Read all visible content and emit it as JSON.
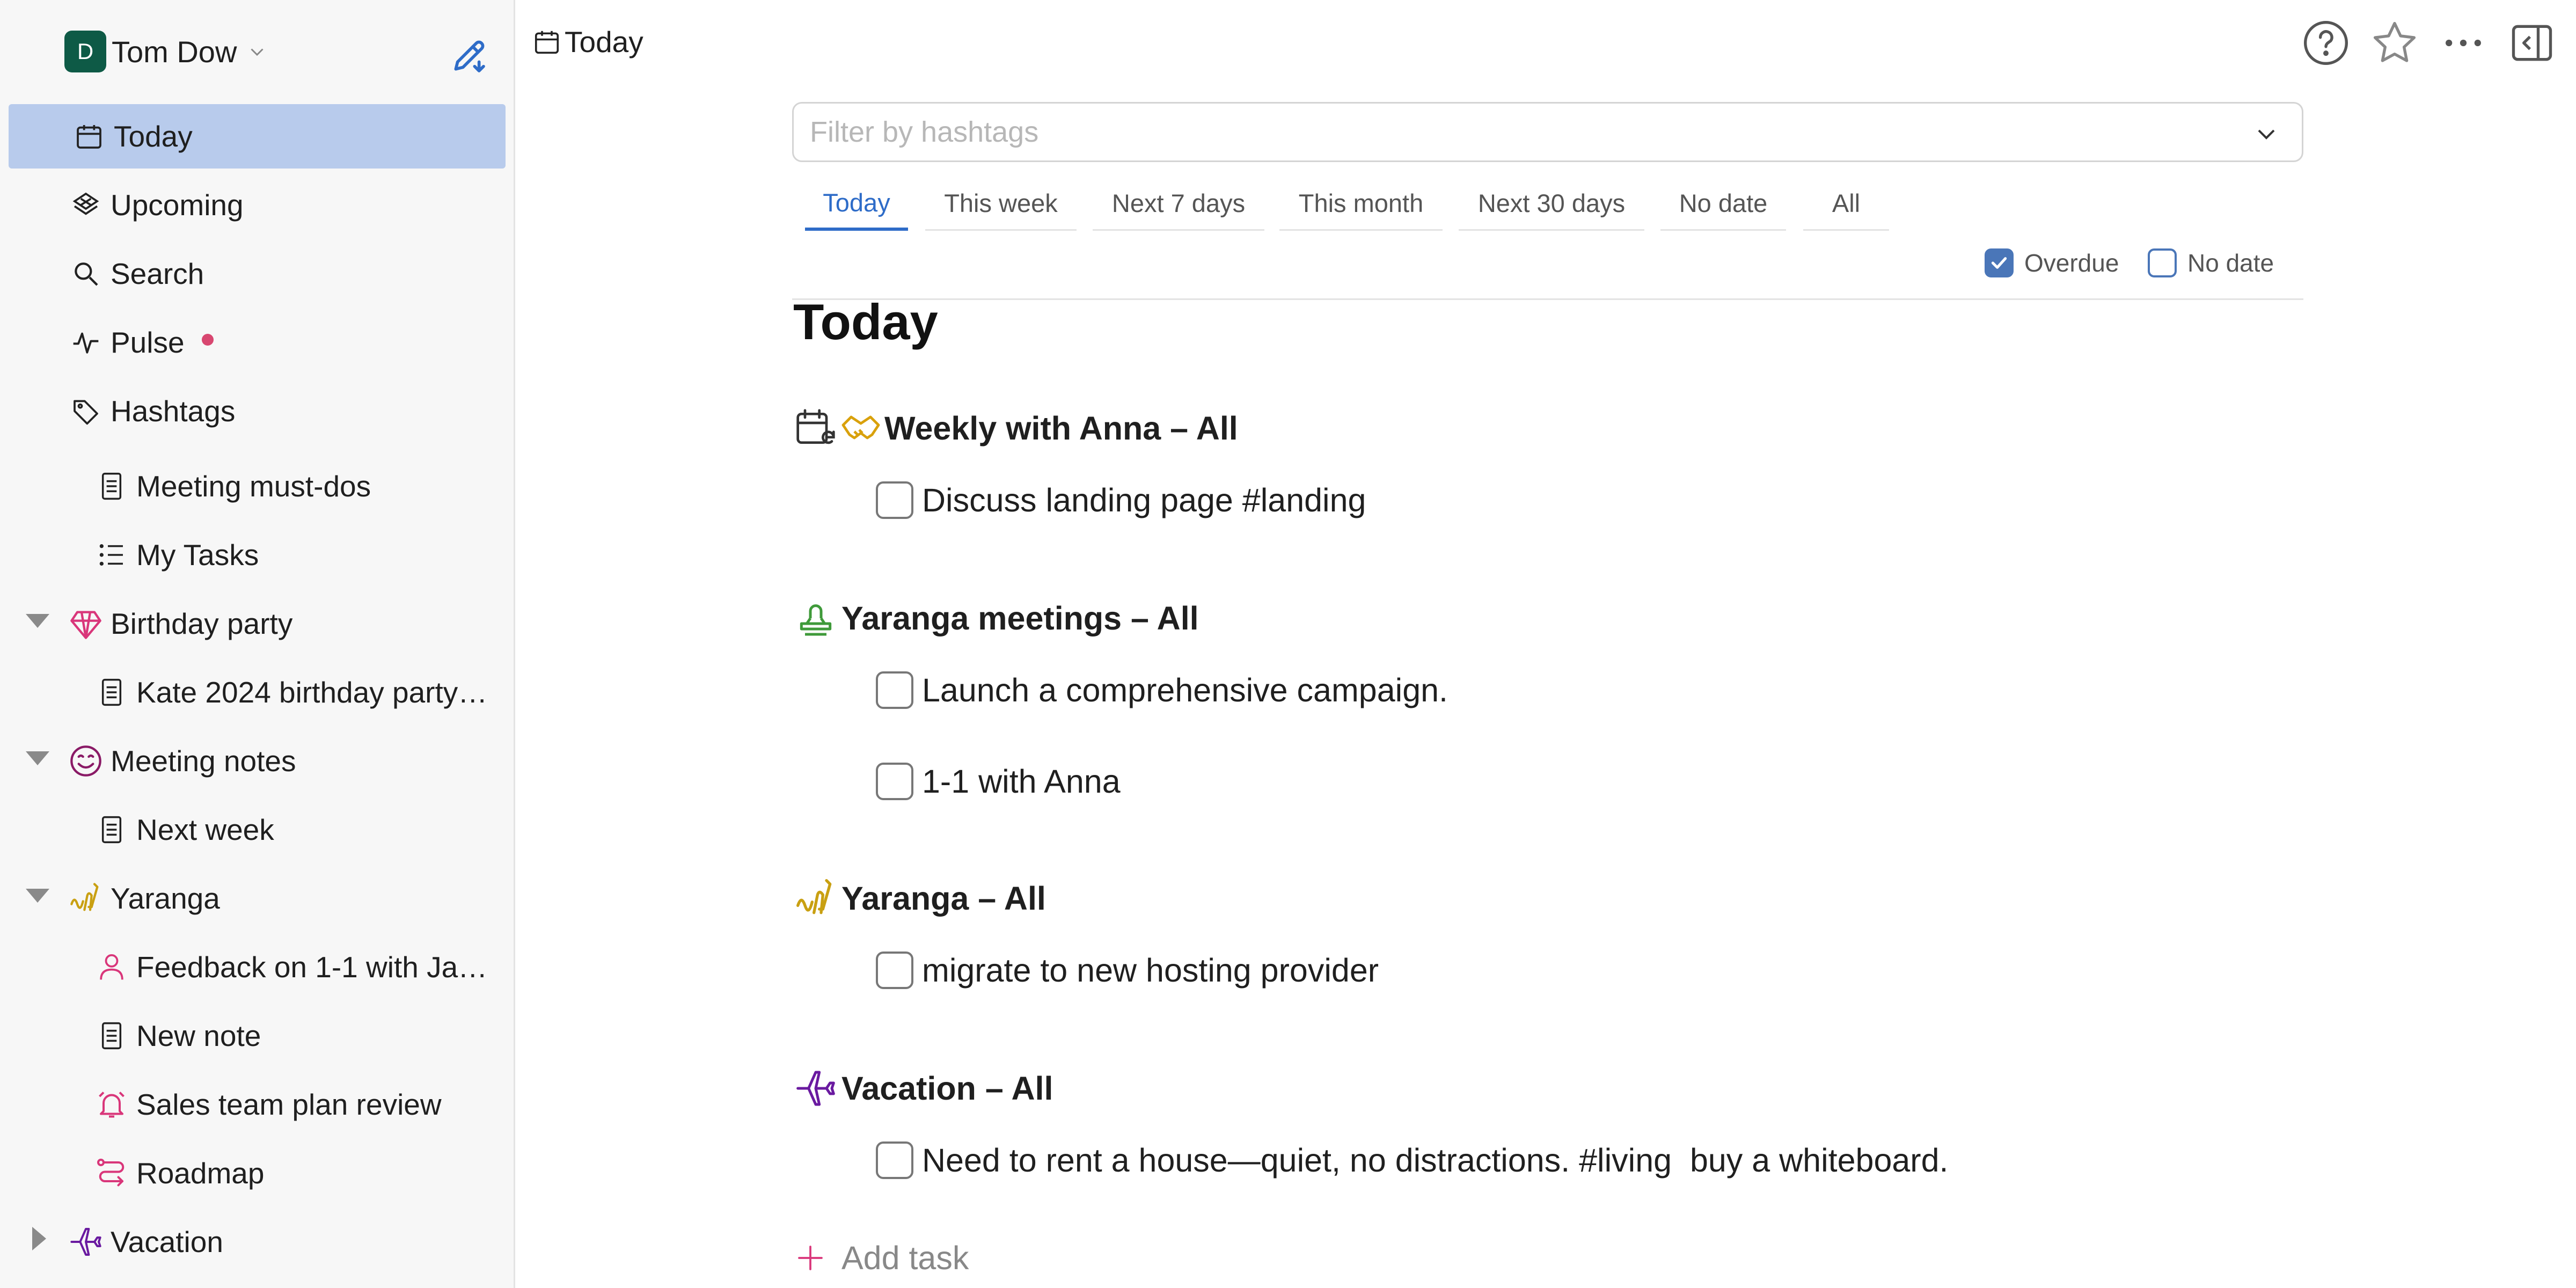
{
  "colors": {
    "accent": "#2e6cc8",
    "active_bg": "#b8cbec",
    "avatar_bg": "#0e5a46",
    "pulse_dot": "#d84770",
    "birthday_icon": "#d9367a",
    "meeting_icon": "#8a1a66",
    "yaranga_icon": "#c9a012",
    "vacation_icon": "#6a1aa0",
    "stamp_icon": "#3f9a3a"
  },
  "account": {
    "avatar_letter": "D",
    "name": "Tom Dow",
    "icon": "chevron-down-icon"
  },
  "sidebar": {
    "new_note_icon": "pencil-edit-icon",
    "items": [
      {
        "label": "Today",
        "icon": "calendar-icon",
        "active": true
      },
      {
        "label": "Upcoming",
        "icon": "upcoming-icon"
      },
      {
        "label": "Search",
        "icon": "search-icon"
      },
      {
        "label": "Pulse",
        "icon": "pulse-icon",
        "has_dot": true
      },
      {
        "label": "Hashtags",
        "icon": "tag-icon"
      },
      {
        "label": "Meeting must-dos",
        "icon": "note-icon"
      },
      {
        "label": "My Tasks",
        "icon": "list-icon"
      },
      {
        "label": "Birthday party",
        "icon": "gem-icon",
        "expanded": true
      },
      {
        "label": "Kate 2024 birthday party…",
        "icon": "note-icon"
      },
      {
        "label": "Meeting notes",
        "icon": "smile-icon",
        "expanded": true
      },
      {
        "label": "Next week",
        "icon": "note-icon"
      },
      {
        "label": "Yaranga",
        "icon": "yaranga-icon",
        "expanded": true
      },
      {
        "label": "Feedback on 1-1 with Ja…",
        "icon": "person-icon"
      },
      {
        "label": "New note",
        "icon": "note-icon"
      },
      {
        "label": "Sales team plan review",
        "icon": "bell-icon"
      },
      {
        "label": "Roadmap",
        "icon": "route-icon"
      },
      {
        "label": "Vacation",
        "icon": "plane-icon",
        "expanded": false
      }
    ]
  },
  "topbar": {
    "title": "Today",
    "icons": [
      "help-icon",
      "star-icon",
      "more-icon",
      "sidebar-toggle-icon"
    ]
  },
  "main": {
    "filter": {
      "placeholder": "Filter by hashtags",
      "value": ""
    },
    "tabs": [
      {
        "label": "Today",
        "active": true
      },
      {
        "label": "This week"
      },
      {
        "label": "Next 7 days"
      },
      {
        "label": "This month"
      },
      {
        "label": "Next 30 days"
      },
      {
        "label": "No date"
      },
      {
        "label": "All"
      }
    ],
    "toggles": {
      "overdue": {
        "label": "Overdue",
        "checked": true
      },
      "nodate": {
        "label": "No date",
        "checked": false
      }
    },
    "heading": "Today",
    "groups": [
      {
        "title": "Weekly with Anna – All",
        "icons": [
          "recurring-calendar-icon",
          "handshake-icon"
        ],
        "tasks": [
          "Discuss landing page #landing"
        ]
      },
      {
        "title": "Yaranga meetings – All",
        "icons": [
          "stamp-icon"
        ],
        "tasks": [
          "Launch a comprehensive campaign.",
          "1-1 with Anna"
        ]
      },
      {
        "title": "Yaranga – All",
        "icons": [
          "yaranga-icon"
        ],
        "tasks": [
          "migrate to new hosting provider"
        ]
      },
      {
        "title": "Vacation – All",
        "icons": [
          "plane-icon"
        ],
        "tasks": [
          "Need to rent a house—quiet, no distractions. #living  buy a whiteboard."
        ]
      }
    ],
    "add_task_label": "Add task"
  }
}
